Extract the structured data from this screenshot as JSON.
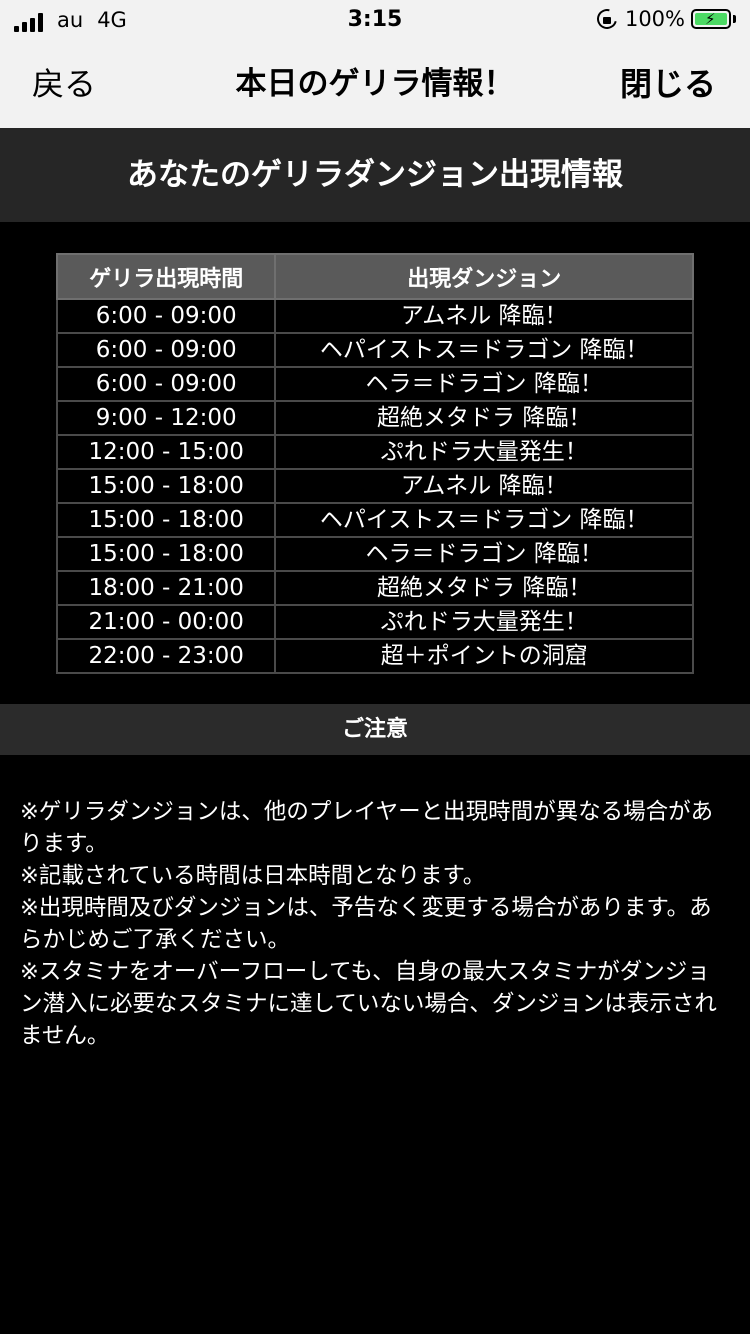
{
  "status": {
    "carrier": "au",
    "network": "4G",
    "time": "3:15",
    "battery": "100%"
  },
  "nav": {
    "back": "戻る",
    "title": "本日のゲリラ情報！",
    "close": "閉じる"
  },
  "section_title": "あなたのゲリラダンジョン出現情報",
  "table": {
    "headers": [
      "ゲリラ出現時間",
      "出現ダンジョン"
    ],
    "rows": [
      [
        "6:00 - 09:00",
        "アムネル 降臨！"
      ],
      [
        "6:00 - 09:00",
        "ヘパイストス＝ドラゴン 降臨！"
      ],
      [
        "6:00 - 09:00",
        "ヘラ＝ドラゴン 降臨！"
      ],
      [
        "9:00 - 12:00",
        "超絶メタドラ 降臨！"
      ],
      [
        "12:00 - 15:00",
        "ぷれドラ大量発生！"
      ],
      [
        "15:00 - 18:00",
        "アムネル 降臨！"
      ],
      [
        "15:00 - 18:00",
        "ヘパイストス＝ドラゴン 降臨！"
      ],
      [
        "15:00 - 18:00",
        "ヘラ＝ドラゴン 降臨！"
      ],
      [
        "18:00 - 21:00",
        "超絶メタドラ 降臨！"
      ],
      [
        "21:00 - 00:00",
        "ぷれドラ大量発生！"
      ],
      [
        "22:00 - 23:00",
        "超＋ポイントの洞窟"
      ]
    ]
  },
  "notice": {
    "title": "ご注意",
    "lines": [
      "※ゲリラダンジョンは、他のプレイヤーと出現時間が異なる場合があります。",
      "※記載されている時間は日本時間となります。",
      "※出現時間及びダンジョンは、予告なく変更する場合があります。あらかじめご了承ください。",
      "※スタミナをオーバーフローしても、自身の最大スタミナがダンジョン潜入に必要なスタミナに達していない場合、ダンジョンは表示されません。"
    ]
  }
}
